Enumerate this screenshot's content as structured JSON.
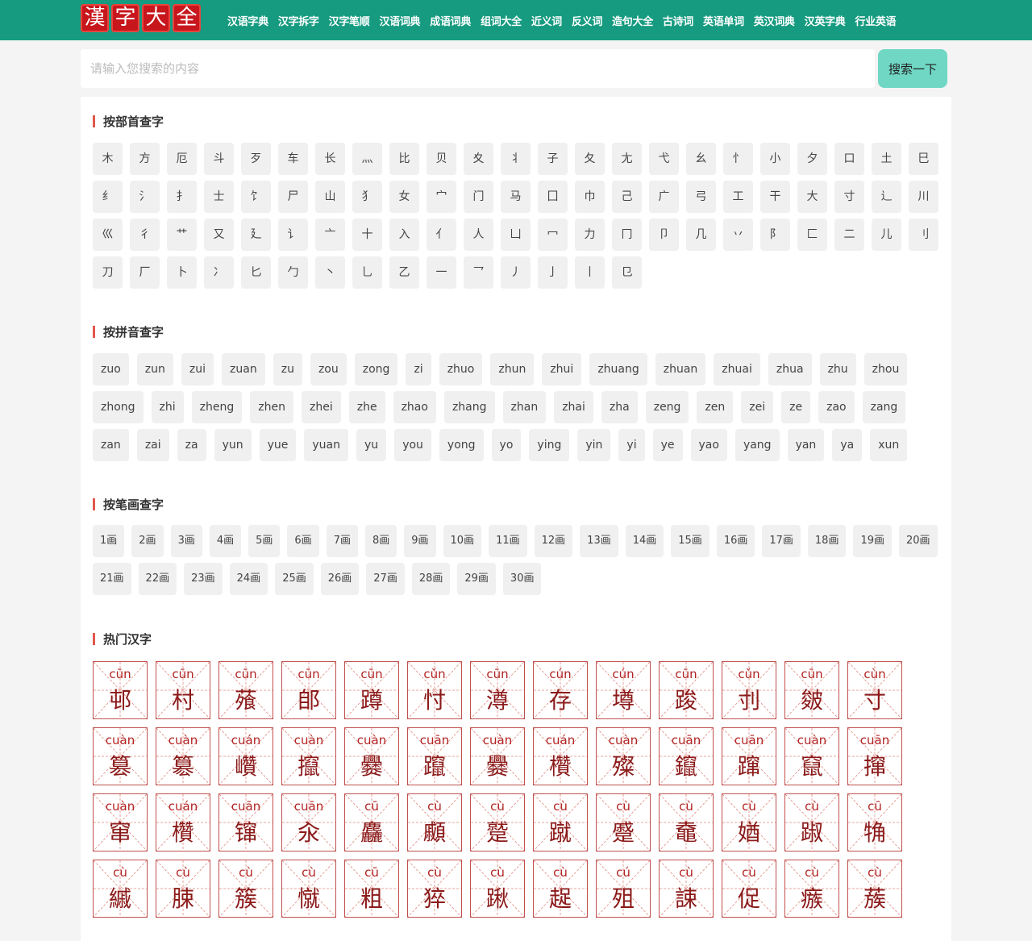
{
  "logo": [
    "漢",
    "字",
    "大",
    "全"
  ],
  "nav": [
    "汉语字典",
    "汉字拆字",
    "汉字笔顺",
    "汉语词典",
    "成语词典",
    "组词大全",
    "近义词",
    "反义词",
    "造句大全",
    "古诗词",
    "英语单词",
    "英汉词典",
    "汉英字典",
    "行业英语"
  ],
  "search": {
    "placeholder": "请输入您搜索的内容",
    "button": "搜索一下"
  },
  "sections": {
    "radical_title": "按部首查字",
    "pinyin_title": "按拼音查字",
    "stroke_title": "按笔画查字",
    "hot_title": "热门汉字"
  },
  "radicals": [
    "木",
    "方",
    "厄",
    "斗",
    "歹",
    "车",
    "长",
    "灬",
    "比",
    "贝",
    "夊",
    "丬",
    "子",
    "夂",
    "尢",
    "弋",
    "幺",
    "忄",
    "小",
    "夕",
    "口",
    "土",
    "巳",
    "纟",
    "氵",
    "扌",
    "士",
    "饣",
    "尸",
    "山",
    "犭",
    "女",
    "宀",
    "门",
    "马",
    "囗",
    "巾",
    "己",
    "广",
    "弓",
    "工",
    "干",
    "大",
    "寸",
    "辶",
    "川",
    "巛",
    "彳",
    "艹",
    "又",
    "廴",
    "讠",
    "亠",
    "十",
    "入",
    "亻",
    "人",
    "凵",
    "冖",
    "力",
    "冂",
    "卩",
    "几",
    "丷",
    "阝",
    "匚",
    "二",
    "儿",
    "刂",
    "刀",
    "厂",
    "卜",
    "冫",
    "匕",
    "勹",
    "丶",
    "乚",
    "乙",
    "一",
    "乛",
    "丿",
    "亅",
    "丨",
    "㔾"
  ],
  "pinyin": [
    "zuo",
    "zun",
    "zui",
    "zuan",
    "zu",
    "zou",
    "zong",
    "zi",
    "zhuo",
    "zhun",
    "zhui",
    "zhuang",
    "zhuan",
    "zhuai",
    "zhua",
    "zhu",
    "zhou",
    "zhong",
    "zhi",
    "zheng",
    "zhen",
    "zhei",
    "zhe",
    "zhao",
    "zhang",
    "zhan",
    "zhai",
    "zha",
    "zeng",
    "zen",
    "zei",
    "ze",
    "zao",
    "zang",
    "zan",
    "zai",
    "za",
    "yun",
    "yue",
    "yuan",
    "yu",
    "you",
    "yong",
    "yo",
    "ying",
    "yin",
    "yi",
    "ye",
    "yao",
    "yang",
    "yan",
    "ya",
    "xun"
  ],
  "strokes": [
    "1画",
    "2画",
    "3画",
    "4画",
    "5画",
    "6画",
    "7画",
    "8画",
    "9画",
    "10画",
    "11画",
    "12画",
    "13画",
    "14画",
    "15画",
    "16画",
    "17画",
    "18画",
    "19画",
    "20画",
    "21画",
    "22画",
    "23画",
    "24画",
    "25画",
    "26画",
    "27画",
    "28画",
    "29画",
    "30画"
  ],
  "hot_chars": [
    {
      "py": "cūn",
      "hz": "邨"
    },
    {
      "py": "cūn",
      "hz": "村"
    },
    {
      "py": "cūn",
      "hz": "蕵"
    },
    {
      "py": "cūn",
      "hz": "郋"
    },
    {
      "py": "cūn",
      "hz": "蹲"
    },
    {
      "py": "cǔn",
      "hz": "忖"
    },
    {
      "py": "cūn",
      "hz": "澊"
    },
    {
      "py": "cún",
      "hz": "存"
    },
    {
      "py": "cún",
      "hz": "墫"
    },
    {
      "py": "cūn",
      "hz": "踆"
    },
    {
      "py": "cǔn",
      "hz": "刌"
    },
    {
      "py": "cūn",
      "hz": "皴"
    },
    {
      "py": "cùn",
      "hz": "寸"
    },
    {
      "py": "cuàn",
      "hz": "篡"
    },
    {
      "py": "cuàn",
      "hz": "簒"
    },
    {
      "py": "cuán",
      "hz": "巑"
    },
    {
      "py": "cuàn",
      "hz": "攛"
    },
    {
      "py": "cuàn",
      "hz": "爨"
    },
    {
      "py": "cuān",
      "hz": "躥"
    },
    {
      "py": "cuàn",
      "hz": "爨"
    },
    {
      "py": "cuán",
      "hz": "欑"
    },
    {
      "py": "cuàn",
      "hz": "殩"
    },
    {
      "py": "cuān",
      "hz": "鑹"
    },
    {
      "py": "cuān",
      "hz": "蹿"
    },
    {
      "py": "cuàn",
      "hz": "竄"
    },
    {
      "py": "cuān",
      "hz": "撺"
    },
    {
      "py": "cuàn",
      "hz": "窜"
    },
    {
      "py": "cuán",
      "hz": "欑"
    },
    {
      "py": "cuān",
      "hz": "镩"
    },
    {
      "py": "cuān",
      "hz": "汆"
    },
    {
      "py": "cū",
      "hz": "麤"
    },
    {
      "py": "cù",
      "hz": "顣"
    },
    {
      "py": "cù",
      "hz": "蹵"
    },
    {
      "py": "cù",
      "hz": "蹴"
    },
    {
      "py": "cù",
      "hz": "蹙"
    },
    {
      "py": "cù",
      "hz": "鼀"
    },
    {
      "py": "cù",
      "hz": "媨"
    },
    {
      "py": "cù",
      "hz": "踧"
    },
    {
      "py": "cū",
      "hz": "觕"
    },
    {
      "py": "cù",
      "hz": "縬"
    },
    {
      "py": "cù",
      "hz": "脨"
    },
    {
      "py": "cù",
      "hz": "簇"
    },
    {
      "py": "cù",
      "hz": "憱"
    },
    {
      "py": "cū",
      "hz": "粗"
    },
    {
      "py": "cù",
      "hz": "猝"
    },
    {
      "py": "cù",
      "hz": "踿"
    },
    {
      "py": "cù",
      "hz": "趗"
    },
    {
      "py": "cú",
      "hz": "殂"
    },
    {
      "py": "cù",
      "hz": "誎"
    },
    {
      "py": "cù",
      "hz": "促"
    },
    {
      "py": "cù",
      "hz": "瘯"
    },
    {
      "py": "cù",
      "hz": "蔟"
    }
  ]
}
